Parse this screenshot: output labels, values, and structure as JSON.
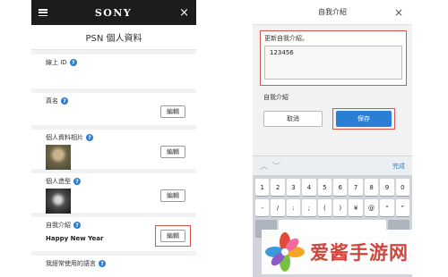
{
  "left": {
    "brand": "SONY",
    "page_title": "PSN 個人資料",
    "rows": [
      {
        "label": "線上 ID",
        "button": ""
      },
      {
        "label": "真名",
        "button": "編輯"
      },
      {
        "label": "個人資料相片",
        "button": "編輯"
      },
      {
        "label": "個人造型",
        "button": "編輯"
      },
      {
        "label": "自我介紹",
        "value": "Happy New Year",
        "button": "編輯"
      },
      {
        "label": "我經常使用的語言",
        "button": ""
      }
    ]
  },
  "right": {
    "title": "自我介紹",
    "update_label": "更新自我介紹。",
    "input_value": "123456",
    "self_intro_label": "自我介紹",
    "cancel_label": "取消",
    "save_label": "保存",
    "done_label": "完成",
    "keyboard_rows": [
      [
        "1",
        "2",
        "3",
        "4",
        "5",
        "6",
        "7",
        "8",
        "9",
        "0"
      ],
      [
        "-",
        "/",
        ":",
        ";",
        "(",
        ")",
        "¥",
        "@",
        "“",
        "”"
      ]
    ]
  },
  "watermark": {
    "text": "爱酱手游网"
  },
  "colors": {
    "accent": "#2a7fd4",
    "highlight": "#d9534f",
    "topbar": "#1c1c1c"
  }
}
